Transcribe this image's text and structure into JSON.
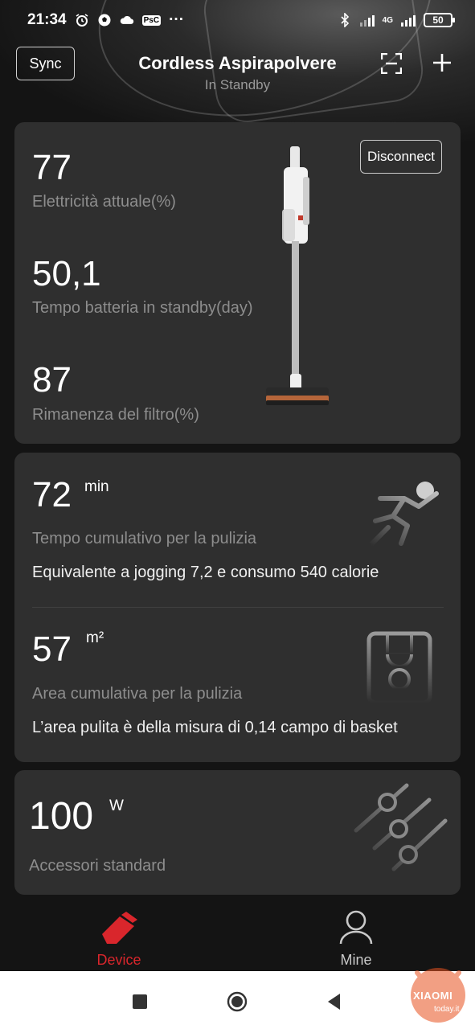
{
  "status_bar": {
    "time": "21:34",
    "psc_label": "PsC",
    "more": "···",
    "network": "4G",
    "battery": "50",
    "icons": [
      "alarm-icon",
      "soccer-ball-icon",
      "cloud-icon",
      "psc-icon",
      "bluetooth-icon",
      "signal-icon",
      "battery-icon"
    ]
  },
  "header": {
    "sync_label": "Sync",
    "title": "Cordless Aspirapolvere",
    "subtitle": "In Standby",
    "icons": [
      "scan-icon",
      "plus-icon"
    ]
  },
  "status_card": {
    "disconnect_label": "Disconnect",
    "metrics": [
      {
        "value": "77",
        "label": "Elettricità attuale(%)"
      },
      {
        "value": "50,1",
        "label": "Tempo batteria in standby(day)"
      },
      {
        "value": "87",
        "label": "Rimanenza del filtro(%)"
      }
    ]
  },
  "cumulative_card": {
    "time": {
      "value": "72",
      "unit": "min",
      "label": "Tempo cumulativo per la pulizia",
      "description": "Equivalente a jogging 7,2 e consumo 540 calorie",
      "icon": "runner-icon"
    },
    "area": {
      "value": "57",
      "unit": "m²",
      "label": "Area cumulativa per la pulizia",
      "description": "L’area pulita è della misura di 0,14 campo di basket",
      "icon": "basketball-court-icon"
    }
  },
  "power_card": {
    "value": "100",
    "unit": "W",
    "label": "Accessori standard",
    "icon": "sliders-icon"
  },
  "bottom_nav": {
    "items": [
      {
        "label": "Device",
        "icon": "eraser-device-icon",
        "active": true
      },
      {
        "label": "Mine",
        "icon": "person-icon",
        "active": false
      }
    ]
  },
  "watermark": {
    "brand": "XIAOMI",
    "domain": "today.it"
  },
  "colors": {
    "accent": "#d9262c",
    "card_bg": "#2f2f2f",
    "page_bg": "#141414",
    "label_gray": "#8d8d8d"
  }
}
